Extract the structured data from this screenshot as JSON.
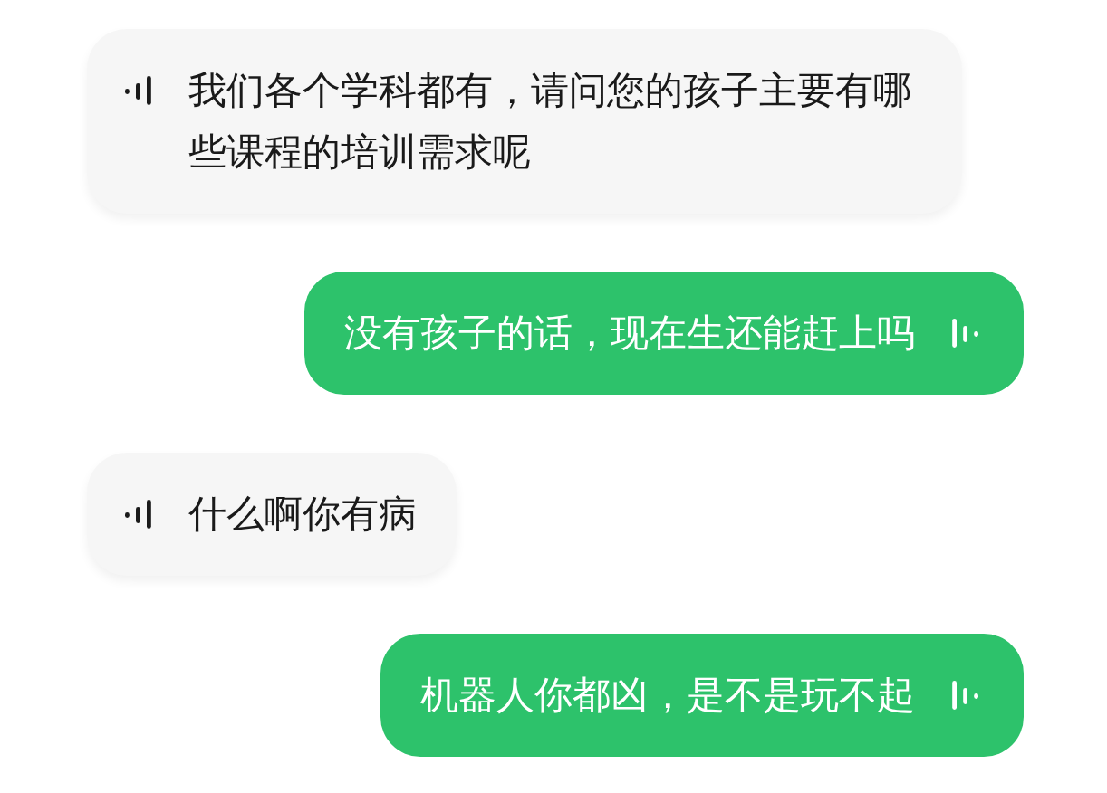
{
  "messages": [
    {
      "kind": "received",
      "text": "我们各个学科都有，请问您的孩子主要有哪些课程的培训需求呢"
    },
    {
      "kind": "sent",
      "text": "没有孩子的话，现在生还能赶上吗"
    },
    {
      "kind": "received",
      "text": "什么啊你有病"
    },
    {
      "kind": "sent",
      "text": "机器人你都凶，是不是玩不起"
    }
  ]
}
